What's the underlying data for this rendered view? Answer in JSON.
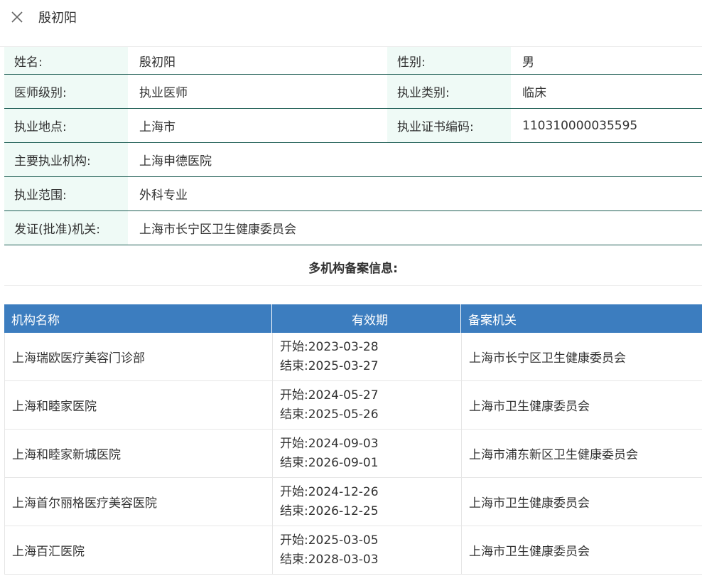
{
  "header": {
    "title": "殷初阳"
  },
  "icons": {
    "close": "close-icon"
  },
  "info": {
    "name_label": "姓名:",
    "name_value": "殷初阳",
    "gender_label": "性别:",
    "gender_value": "男",
    "level_label": "医师级别:",
    "level_value": "执业医师",
    "category_label": "执业类别:",
    "category_value": "临床",
    "location_label": "执业地点:",
    "location_value": "上海市",
    "cert_label": "执业证书编码:",
    "cert_value": "110310000035595",
    "org_label": "主要执业机构:",
    "org_value": "上海申德医院",
    "scope_label": "执业范围:",
    "scope_value": "外科专业",
    "authority_label": "发证(批准)机关:",
    "authority_value": "上海市长宁区卫生健康委员会"
  },
  "section_title": "多机构备案信息:",
  "filing": {
    "columns": [
      "机构名称",
      "有效期",
      "备案机关"
    ],
    "rows": [
      {
        "org": "上海瑞欧医疗美容门诊部",
        "start": "开始:2023-03-28",
        "end": "结束:2025-03-27",
        "authority": "上海市长宁区卫生健康委员会"
      },
      {
        "org": "上海和睦家医院",
        "start": "开始:2024-05-27",
        "end": "结束:2025-05-26",
        "authority": "上海市卫生健康委员会"
      },
      {
        "org": "上海和睦家新城医院",
        "start": "开始:2024-09-03",
        "end": "结束:2026-09-01",
        "authority": "上海市浦东新区卫生健康委员会"
      },
      {
        "org": "上海首尔丽格医疗美容医院",
        "start": "开始:2024-12-26",
        "end": "结束:2026-12-25",
        "authority": "上海市卫生健康委员会"
      },
      {
        "org": "上海百汇医院",
        "start": "开始:2025-03-05",
        "end": "结束:2028-03-03",
        "authority": "上海市卫生健康委员会"
      }
    ]
  },
  "colors": {
    "header_blue": "#3c7dbf",
    "label_bg": "#effaf6",
    "row_border": "#1f5e55"
  }
}
